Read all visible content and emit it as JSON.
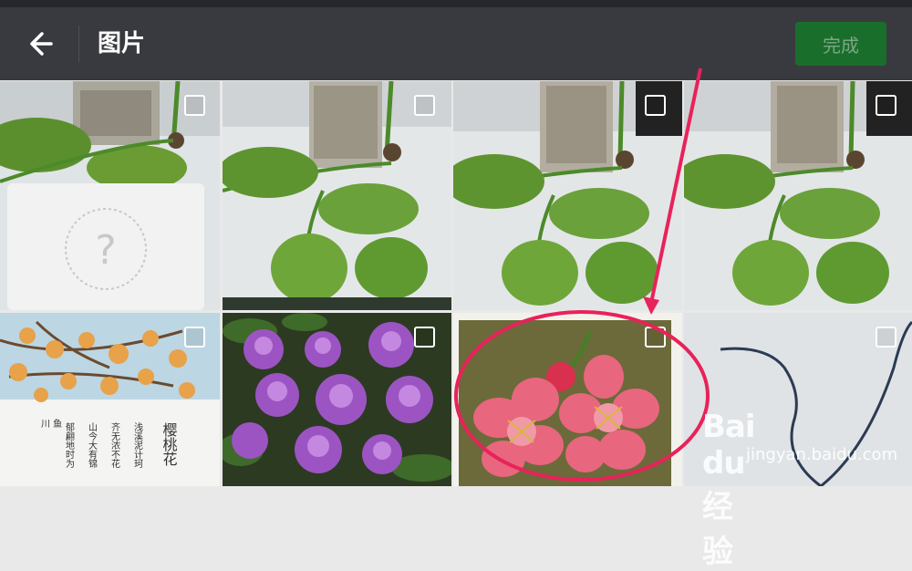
{
  "header": {
    "back_icon": "back-arrow-icon",
    "title": "图片",
    "done_label": "完成"
  },
  "colors": {
    "header_bg": "#393a3f",
    "done_bg": "#1a6e2c",
    "annotation": "#e8225a"
  },
  "grid": {
    "photos": [
      {
        "subject": "plant-with-placeholder",
        "selected": false
      },
      {
        "subject": "plant",
        "selected": false
      },
      {
        "subject": "plant",
        "selected": false
      },
      {
        "subject": "plant",
        "selected": false
      },
      {
        "subject": "cherry-blossom-poem",
        "selected": false
      },
      {
        "subject": "purple-flowers",
        "selected": false
      },
      {
        "subject": "pink-flower",
        "selected": false
      },
      {
        "subject": "white-surface-cable",
        "selected": false
      }
    ],
    "poem_title": "樱桃花"
  },
  "watermark": {
    "logo": "Bai du 经验",
    "url": "jingyan.baidu.com"
  }
}
